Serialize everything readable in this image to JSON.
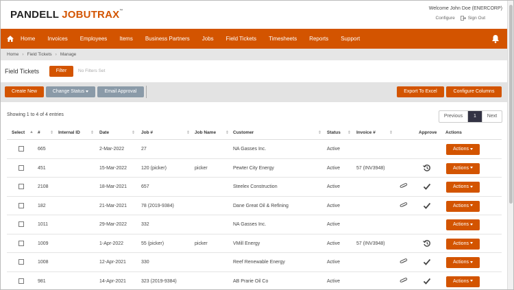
{
  "header": {
    "logo_part1": "PANDELL ",
    "logo_part2": "JOBUTRAX",
    "logo_tm": "™",
    "welcome": "Welcome John Doe (ENERCORP)",
    "configure_link": "Configure",
    "signout_link": "Sign Out"
  },
  "nav": {
    "items": [
      "Home",
      "Invoices",
      "Employees",
      "Items",
      "Business Partners",
      "Jobs",
      "Field Tickets",
      "Timesheets",
      "Reports",
      "Support"
    ]
  },
  "breadcrumb": [
    "Home",
    "Field Tickets",
    "Manage"
  ],
  "page": {
    "title": "Field Tickets",
    "filter_label": "Filter",
    "filters_set": "No Filters Set"
  },
  "toolbar": {
    "create_new": "Create New",
    "change_status": "Change Status",
    "email_approval": "Email Approval",
    "export_excel": "Export To Excel",
    "configure_columns": "Configure Columns"
  },
  "entries_text": "Showing 1 to 4 of 4 entries",
  "pager": {
    "previous": "Previous",
    "current": "1",
    "next": "Next"
  },
  "table": {
    "columns": [
      "Select",
      "#",
      "Internal ID",
      "Date",
      "Job #",
      "Job Name",
      "Customer",
      "Status",
      "Invoice #",
      "Approve",
      "Actions"
    ],
    "action_label": "Actions",
    "rows": [
      {
        "num": "665",
        "internal_id": "",
        "date": "2-Mar-2022",
        "job": "27",
        "job_name": "",
        "customer": "NA Gasses Inc.",
        "status": "Active",
        "invoice": "",
        "attach": false,
        "approve": "none"
      },
      {
        "num": "451",
        "internal_id": "",
        "date": "15-Mar-2022",
        "job": "120 (picker)",
        "job_name": "picker",
        "customer": "Pewter City Energy",
        "status": "Active",
        "invoice": "57 (INV3948)",
        "attach": false,
        "approve": "history"
      },
      {
        "num": "2108",
        "internal_id": "",
        "date": "18-Mar-2021",
        "job": "657",
        "job_name": "",
        "customer": "Steelex Construction",
        "status": "Active",
        "invoice": "",
        "attach": true,
        "approve": "check"
      },
      {
        "num": "182",
        "internal_id": "",
        "date": "21-Mar-2021",
        "job": "78 (2019-9384)",
        "job_name": "",
        "customer": "Dane Great Oil & Refining",
        "status": "Active",
        "invoice": "",
        "attach": true,
        "approve": "check"
      },
      {
        "num": "1011",
        "internal_id": "",
        "date": "29-Mar-2022",
        "job": "332",
        "job_name": "",
        "customer": "NA Gasses Inc.",
        "status": "Active",
        "invoice": "",
        "attach": false,
        "approve": "none"
      },
      {
        "num": "1009",
        "internal_id": "",
        "date": "1-Apr-2022",
        "job": "55 (picker)",
        "job_name": "picker",
        "customer": "VMill Energy",
        "status": "Active",
        "invoice": "57 (INV3948)",
        "attach": false,
        "approve": "history"
      },
      {
        "num": "1008",
        "internal_id": "",
        "date": "12-Apr-2021",
        "job": "330",
        "job_name": "",
        "customer": "Reef Renewable Energy",
        "status": "Active",
        "invoice": "",
        "attach": true,
        "approve": "check"
      },
      {
        "num": "981",
        "internal_id": "",
        "date": "14-Apr-2021",
        "job": "323 (2019-9384)",
        "job_name": "",
        "customer": "AB Prarie Oil Co",
        "status": "Active",
        "invoice": "",
        "attach": true,
        "approve": "check"
      }
    ]
  },
  "colors": {
    "accent": "#d35400",
    "gray_button": "#8a9aa8"
  }
}
